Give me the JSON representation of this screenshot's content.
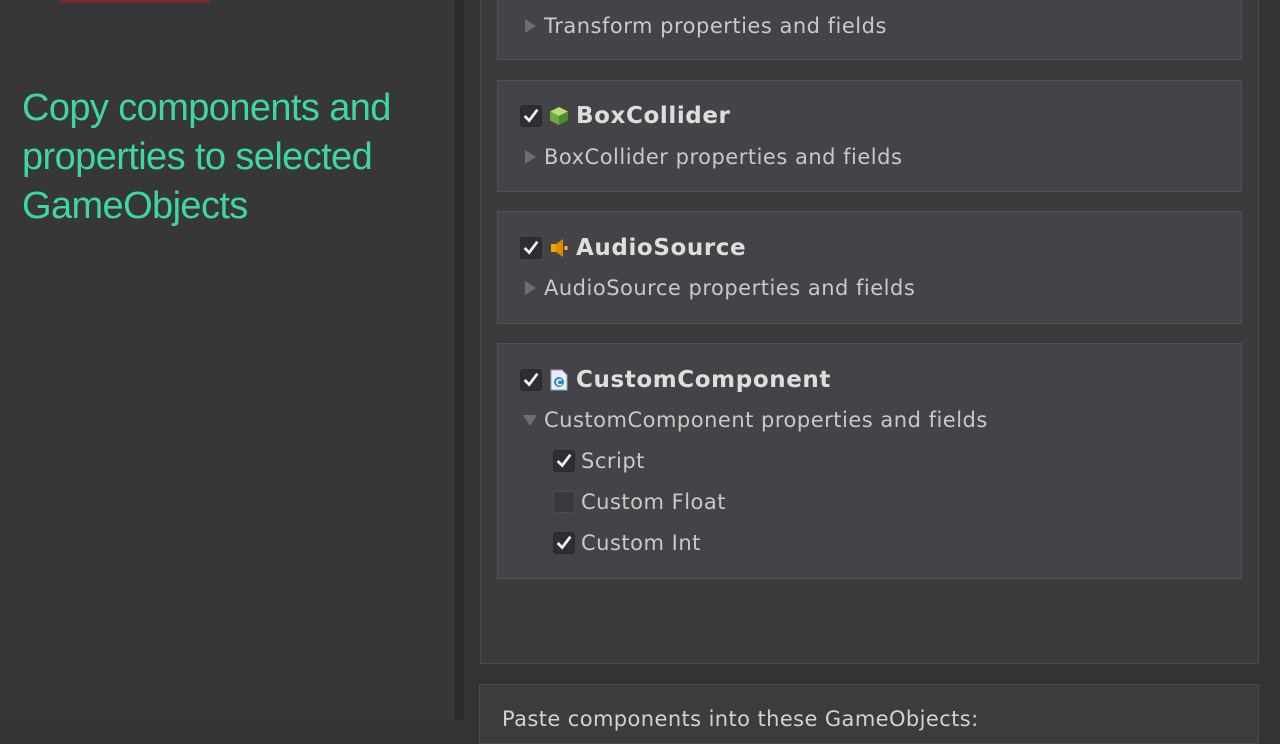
{
  "caption": {
    "text": "Copy components and properties to selected GameObjects",
    "color": "#3fd7a0"
  },
  "components": [
    {
      "name": "",
      "checked": true,
      "icon": "transform-icon",
      "foldout_label": "Transform properties and fields",
      "expanded": false
    },
    {
      "name": "BoxCollider",
      "checked": true,
      "icon": "green-cube-icon",
      "foldout_label": "BoxCollider properties and fields",
      "expanded": false
    },
    {
      "name": "AudioSource",
      "checked": true,
      "icon": "speaker-icon",
      "foldout_label": "AudioSource properties and fields",
      "expanded": false
    },
    {
      "name": "CustomComponent",
      "checked": true,
      "icon": "script-file-icon",
      "foldout_label": "CustomComponent properties and fields",
      "expanded": true,
      "properties": [
        {
          "label": "Script",
          "checked": true
        },
        {
          "label": "Custom Float",
          "checked": false
        },
        {
          "label": "Custom Int",
          "checked": true
        }
      ]
    }
  ],
  "paste_section": {
    "label": "Paste components into these GameObjects:"
  }
}
